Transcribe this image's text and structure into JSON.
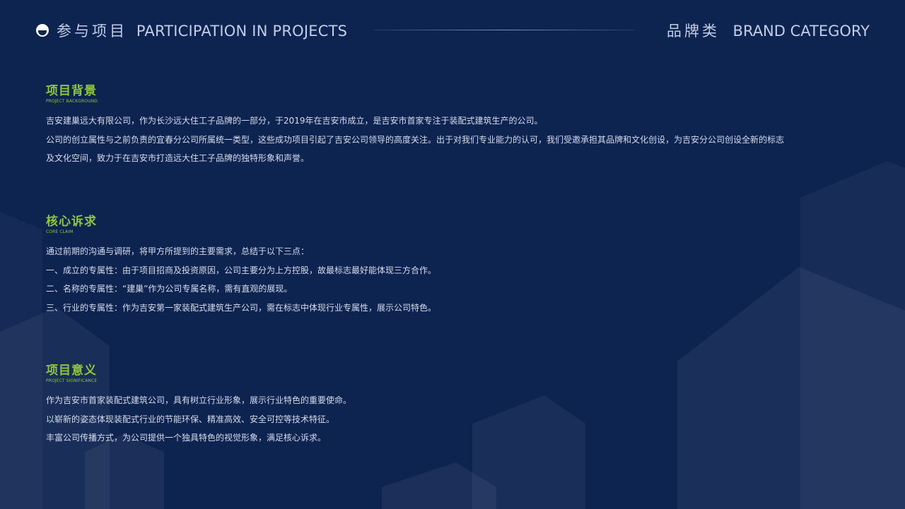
{
  "header": {
    "left_cn": "参与项目",
    "left_en": "PARTICIPATION IN PROJECTS",
    "right_cn": "品牌类",
    "right_en": "BRAND CATEGORY",
    "logo_icon": "circle-smile-icon"
  },
  "colors": {
    "background": "#0d2350",
    "accent": "#8fc63c",
    "text": "#d6dcec"
  },
  "sections": [
    {
      "title": "项目背景",
      "subtitle": "PROJECT BACKGROUND",
      "lines": [
        "吉安建巢远大有限公司，作为长沙远大住工子品牌的一部分，于2019年在吉安市成立，是吉安市首家专注于装配式建筑生产的公司。",
        "公司的创立属性与之前负责的宜春分公司所属统一类型，这些成功项目引起了吉安公司领导的高度关注。出于对我们专业能力的认可，我们受邀承担其品牌和文化创设，为吉安分公司创设全新的标志",
        "及文化空间，致力于在吉安市打造远大住工子品牌的独特形象和声誉。"
      ]
    },
    {
      "title": "核心诉求",
      "subtitle": "CORE CLAIM",
      "lines": [
        "通过前期的沟通与调研，将甲方所提到的主要需求，总结于以下三点：",
        "一、成立的专属性：由于项目招商及投资原因，公司主要分为上方控股，故最标志最好能体现三方合作。",
        "二、名称的专属性：“建巢”作为公司专属名称，需有直观的展现。",
        "三、行业的专属性：作为吉安第一家装配式建筑生产公司，需在标志中体现行业专属性，展示公司特色。"
      ]
    },
    {
      "title": "项目意义",
      "subtitle": "PROJECT SIGNIFICANCE",
      "lines": [
        "作为吉安市首家装配式建筑公司，具有树立行业形象，展示行业特色的重要使命。",
        "以崭新的姿态体现装配式行业的节能环保、精准高效、安全可控等技术特征。",
        "丰富公司传播方式，为公司提供一个独具特色的视觉形象，满足核心诉求。"
      ]
    }
  ]
}
